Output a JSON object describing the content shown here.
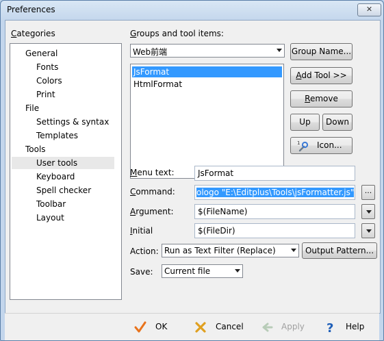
{
  "window": {
    "title": "Preferences",
    "close_label": "✕"
  },
  "categories": {
    "label_prefix": "",
    "label_u": "C",
    "label_rest": "ategories",
    "items": [
      {
        "label": "General",
        "level": 0
      },
      {
        "label": "Fonts",
        "level": 1
      },
      {
        "label": "Colors",
        "level": 1
      },
      {
        "label": "Print",
        "level": 1
      },
      {
        "label": "File",
        "level": 0
      },
      {
        "label": "Settings & syntax",
        "level": 1
      },
      {
        "label": "Templates",
        "level": 1
      },
      {
        "label": "Tools",
        "level": 0
      },
      {
        "label": "User tools",
        "level": 1,
        "selected": true
      },
      {
        "label": "Keyboard",
        "level": 1
      },
      {
        "label": "Spell checker",
        "level": 1
      },
      {
        "label": "Toolbar",
        "level": 1
      },
      {
        "label": "Layout",
        "level": 1
      }
    ]
  },
  "groups": {
    "label_u": "G",
    "label_rest": "roups and tool items:",
    "selected_group": "Web前端",
    "tools": [
      "JsFormat",
      "HtmlFormat"
    ],
    "selected_tool": "JsFormat"
  },
  "buttons": {
    "group_name": "Group Name...",
    "add_tool_u": "A",
    "add_tool_rest": "dd Tool >>",
    "remove_u": "R",
    "remove_rest": "emove",
    "up": "Up",
    "down": "Down",
    "icon": "Icon..."
  },
  "form": {
    "menu_text_u": "M",
    "menu_text_rest": "enu text:",
    "menu_text_value": "JsFormat",
    "command_u": "C",
    "command_rest": "ommand:",
    "command_value": "ologo \"E:\\Editplus\\Tools\\jsFormatter.js\"",
    "argument_u": "A",
    "argument_rest": "rgument:",
    "argument_value": "$(FileName)",
    "initial_u": "I",
    "initial_rest": "nitial",
    "initial_value": "$(FileDir)",
    "action_label": "Action:",
    "action_value": "Run as Text Filter (Replace)",
    "output_pattern": "Output Pattern...",
    "save_label": "Save:",
    "save_value": "Current file",
    "browse_label": "..."
  },
  "footer": {
    "ok": "OK",
    "cancel": "Cancel",
    "apply": "Apply",
    "help": "Help"
  },
  "colors": {
    "selection": "#3399ff",
    "ok_check": "#e8731c",
    "cancel_x": "#e0a020",
    "help": "#1f5fb8"
  }
}
